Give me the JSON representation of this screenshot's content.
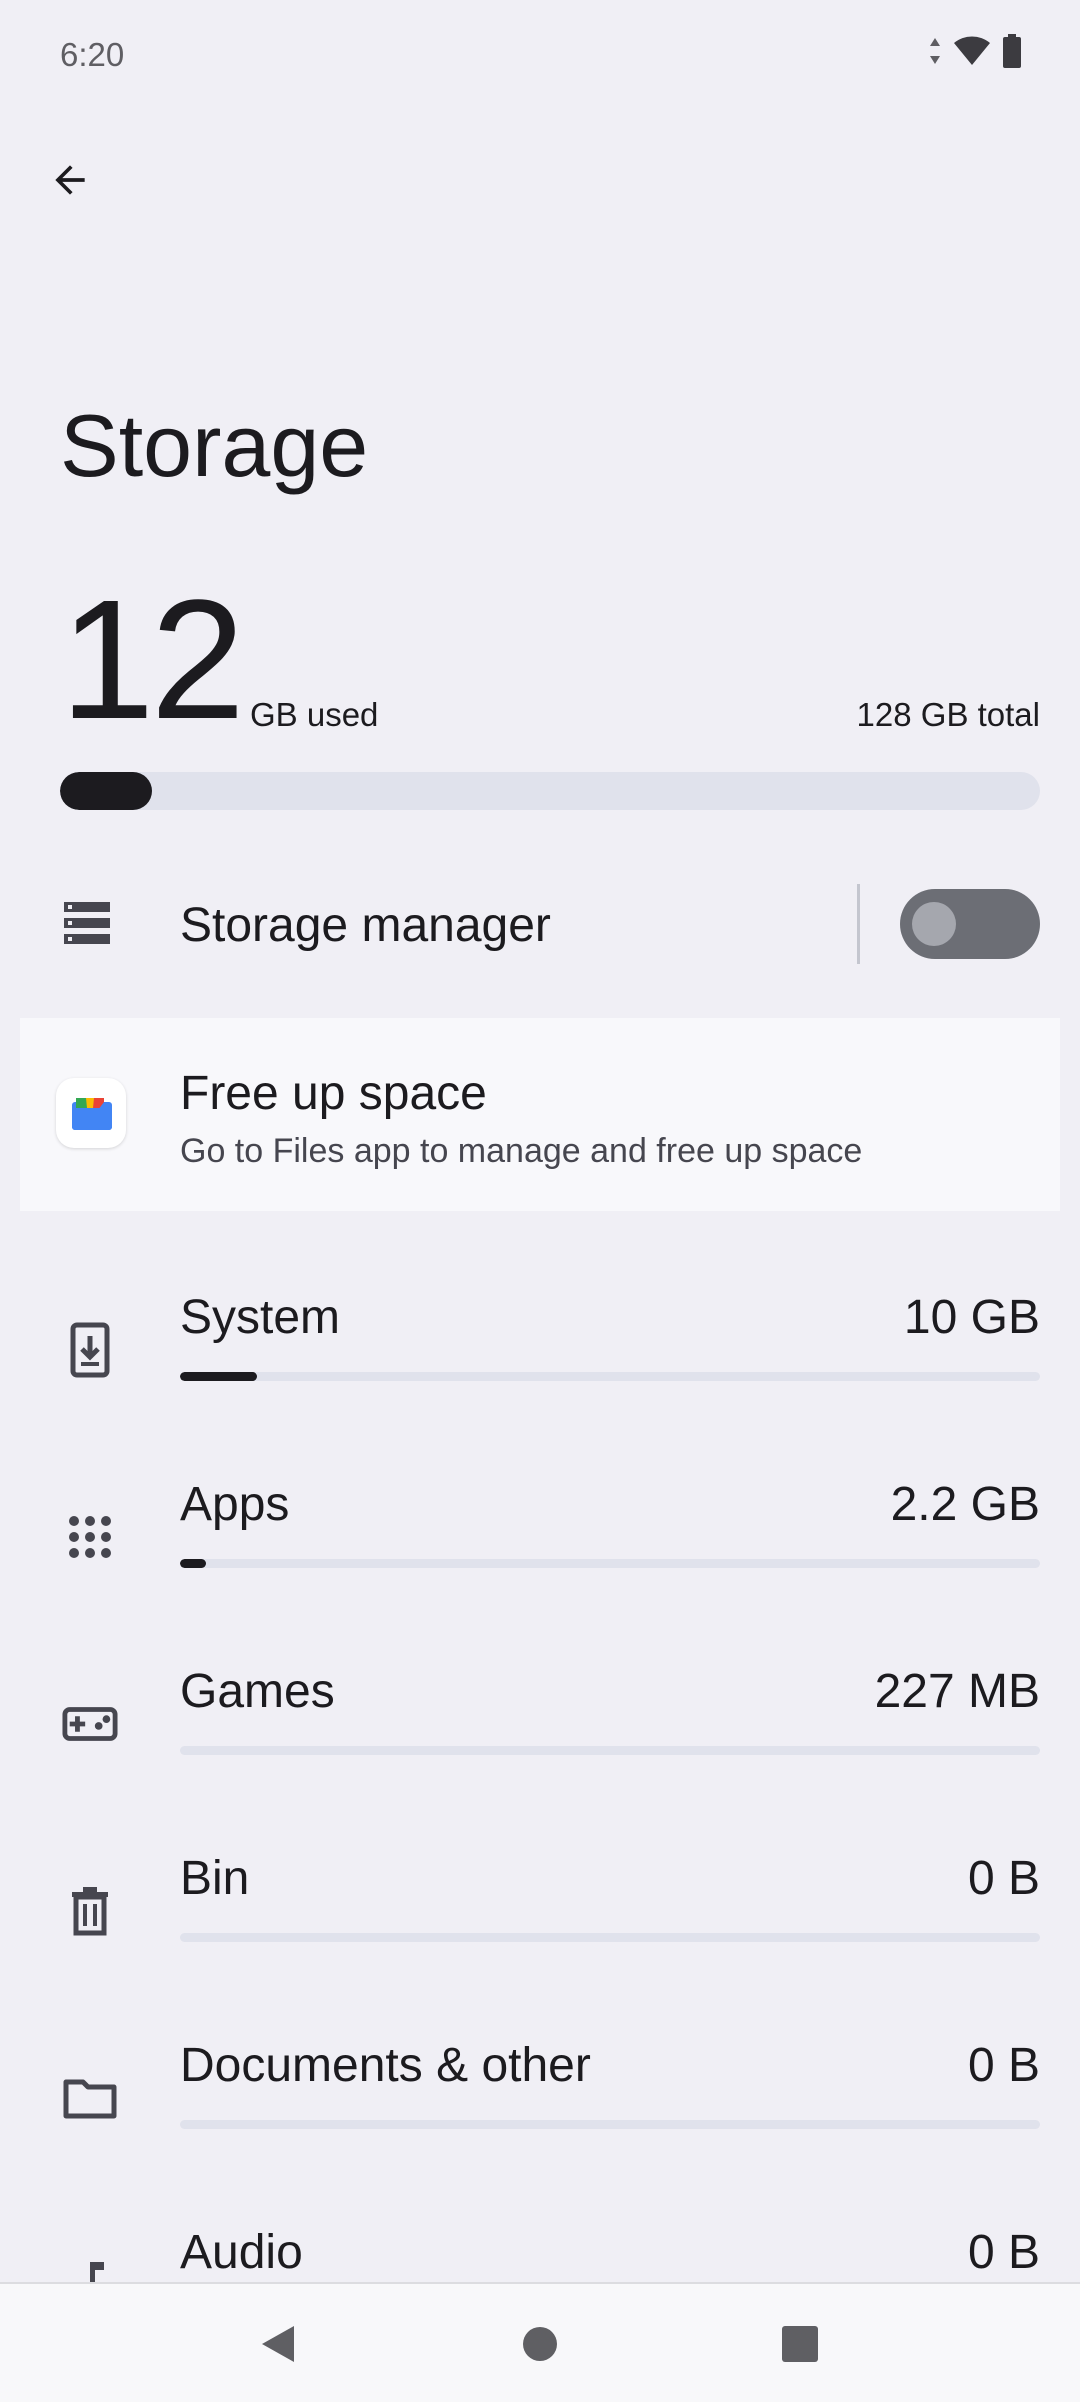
{
  "status_bar": {
    "time": "6:20",
    "icons": [
      "data-arrows-icon",
      "wifi-icon",
      "battery-icon"
    ]
  },
  "header": {
    "back_icon": "arrow-left-icon",
    "title": "Storage"
  },
  "summary": {
    "used_number": "12",
    "used_label": "GB used",
    "total_label": "128 GB total",
    "used_fraction": 0.094
  },
  "storage_manager": {
    "label": "Storage manager",
    "enabled": false,
    "icon": "storage-list-icon"
  },
  "free_up": {
    "title": "Free up space",
    "subtitle": "Go to Files app to manage and free up space",
    "icon": "files-app-icon"
  },
  "categories": [
    {
      "label": "System",
      "value": "10 GB",
      "fraction": 0.09,
      "icon": "system-update-icon"
    },
    {
      "label": "Apps",
      "value": "2.2 GB",
      "fraction": 0.03,
      "icon": "apps-grid-icon"
    },
    {
      "label": "Games",
      "value": "227 MB",
      "fraction": 0.0,
      "icon": "gamepad-icon"
    },
    {
      "label": "Bin",
      "value": "0 B",
      "fraction": 0.0,
      "icon": "trash-icon"
    },
    {
      "label": "Documents & other",
      "value": "0 B",
      "fraction": 0.0,
      "icon": "folder-icon"
    },
    {
      "label": "Audio",
      "value": "0 B",
      "fraction": 0.0,
      "icon": "music-note-icon"
    }
  ],
  "nav_bar": {
    "buttons": [
      "back-triangle-icon",
      "home-circle-icon",
      "recents-square-icon"
    ]
  },
  "colors": {
    "background": "#f0eff5",
    "bar_track": "#e0e2ec",
    "bar_fill": "#1c1b1f",
    "toggle_off": "#6c6e75"
  }
}
